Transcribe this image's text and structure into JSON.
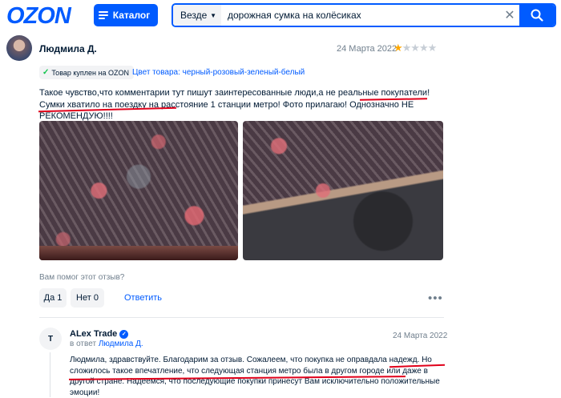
{
  "header": {
    "logo": "OZON",
    "catalog_label": "Каталог",
    "search": {
      "scope": "Везде",
      "query": "дорожная сумка на колёсиках"
    },
    "brand_color": "#005bff"
  },
  "review": {
    "author": "Людмила Д.",
    "date": "24 Марта 2022",
    "rating": 1,
    "rating_max": 5,
    "verified_label": "Товар куплен на OZON",
    "color_label": "Цвет товара: черный-розовый-зеленый-белый",
    "text": "Такое чувство,что комментарии тут пишут заинтересованные люди,а не реальные покупатели! Сумки хватило на поездку на расстояние 1 станции метро! Фото прилагаю! Однозначно НЕ РЕКОМЕНДУЮ!!!!",
    "helpful_question": "Вам помог этот отзыв?",
    "yes_label": "Да 1",
    "no_label": "Нет 0",
    "reply_label": "Ответить",
    "more_label": "•••"
  },
  "seller_reply": {
    "avatar_letter": "T",
    "author": "ALex Trade",
    "verified_mark": "✓",
    "date": "24 Марта 2022",
    "reply_prefix": "в ответ",
    "reply_to": "Людмила Д.",
    "text": "Людмила, здравствуйте. Благодарим за отзыв. Сожалеем, что покупка не оправдала надежд. Но сложилось такое впечатление, что следующая станция метро была в другом городе или даже в другой стране. Надеемся, что последующие покупки принесут Вам исключительно положительные эмоции!"
  },
  "icons": {
    "stars": "★★★★★",
    "check": "✓",
    "clear": "✕",
    "dropdown_caret": "▼"
  },
  "colors": {
    "star_filled": "#ffa800",
    "star_empty": "#c7ced6",
    "highlight_underline": "#e0001a",
    "verified_check": "#10c44c"
  }
}
